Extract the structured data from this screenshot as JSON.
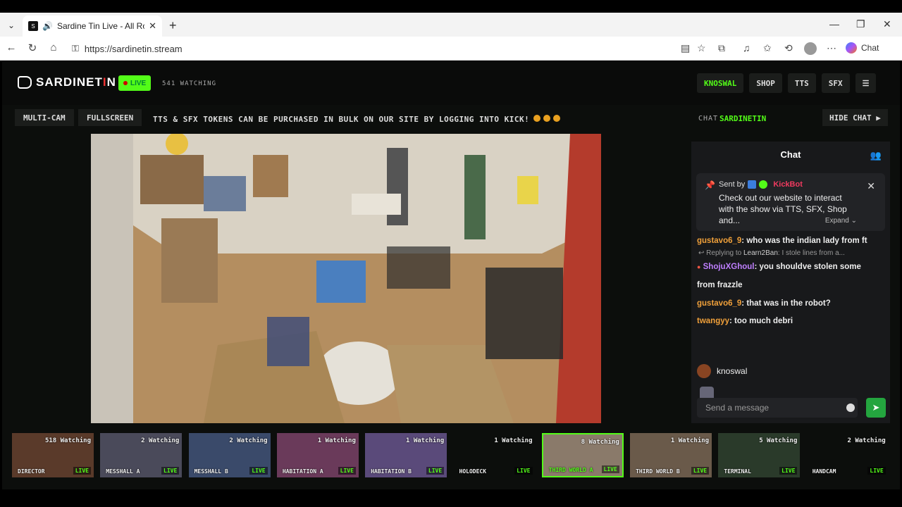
{
  "browser": {
    "tab_title": "Sardine Tin Live - All Rooms, /",
    "url": "https://sardinetin.stream",
    "chat_label": "Chat"
  },
  "site": {
    "logo_text": "SARDINET",
    "logo_red": "I",
    "logo_end": "N",
    "live_label": "LIVE",
    "watching": "541 WATCHING",
    "nav": [
      "KNOSWAL",
      "SHOP",
      "TTS",
      "SFX"
    ],
    "multi_cam": "MULTI-CAM",
    "fullscreen": "FULLSCREEN",
    "ticker": "TTS & SFX TOKENS CAN BE PURCHASED IN BULK ON OUR SITE BY LOGGING INTO KICK!"
  },
  "chat_header": {
    "label": "CHAT",
    "channel": "SARDINETIN",
    "hide_chat": "HIDE CHAT ▶"
  },
  "chat": {
    "title": "Chat",
    "pinned": {
      "sent_by": "Sent by",
      "bot_name": "KickBot",
      "message": "Check out our website to interact with the show via TTS, SFX, Shop and...",
      "expand": "Expand ⌄"
    },
    "messages": [
      {
        "user": "gustavo6_9",
        "text": "who was the indian lady from ft"
      },
      {
        "user": "ShojuXGhoul",
        "text": "you shouldve stolen some"
      },
      {
        "user": "",
        "text": "from frazzle"
      },
      {
        "user": "gustavo6_9",
        "text": "that was in the robot?"
      },
      {
        "user": "twangyy",
        "text": "too much debri"
      }
    ],
    "reply": {
      "prefix": "Replying to",
      "user": "Learn2Ban",
      "text": "I stole lines from a..."
    },
    "me": "knoswal",
    "input_placeholder": "Send a message"
  },
  "cams": [
    {
      "watching": "518 Watching",
      "name": "DIRECTOR",
      "live": "LIVE"
    },
    {
      "watching": "2 Watching",
      "name": "MESSHALL A",
      "live": "LIVE"
    },
    {
      "watching": "2 Watching",
      "name": "MESSHALL B",
      "live": "LIVE"
    },
    {
      "watching": "1 Watching",
      "name": "HABITATION A",
      "live": "LIVE"
    },
    {
      "watching": "1 Watching",
      "name": "HABITATION B",
      "live": "LIVE"
    },
    {
      "watching": "1 Watching",
      "name": "HOLODECK",
      "live": "LIVE"
    },
    {
      "watching": "8 Watching",
      "name": "THIRD WORLD A",
      "live": "LIVE"
    },
    {
      "watching": "1 Watching",
      "name": "THIRD WORLD B",
      "live": "LIVE"
    },
    {
      "watching": "5 Watching",
      "name": "TERMINAL",
      "live": "LIVE"
    },
    {
      "watching": "2 Watching",
      "name": "HANDCAM",
      "live": "LIVE"
    }
  ],
  "colors": {
    "accent": "#53fc18",
    "username": "#f0a03a",
    "bot": "#f03a5f"
  }
}
